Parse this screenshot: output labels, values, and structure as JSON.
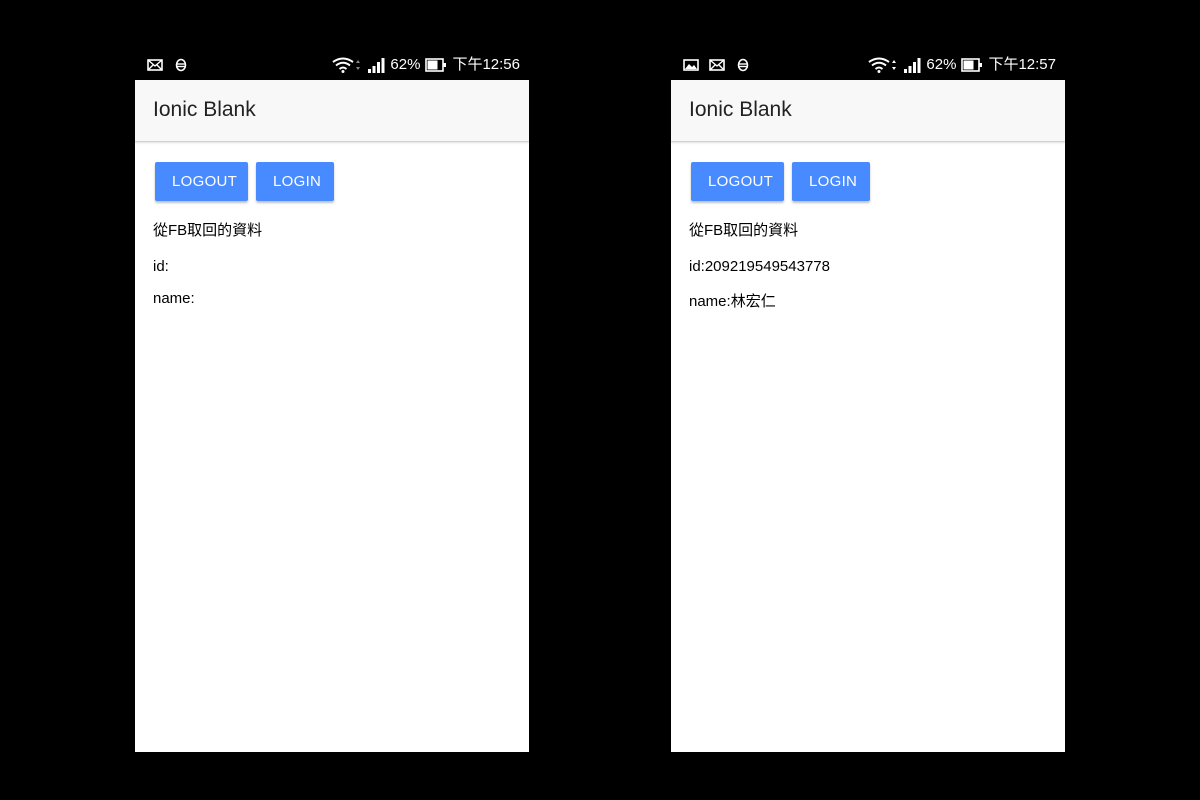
{
  "phones": [
    {
      "status": {
        "notification_icons": [
          "mail-icon",
          "sync-icon"
        ],
        "battery": "62%",
        "time": "下午12:56"
      },
      "toolbar": {
        "title": "Ionic Blank"
      },
      "buttons": {
        "logout": "LOGOUT",
        "login": "LOGIN"
      },
      "heading": "從FB取回的資料",
      "id_line": "id:",
      "name_line": "name:"
    },
    {
      "status": {
        "notification_icons": [
          "image-icon",
          "mail-icon",
          "sync-icon"
        ],
        "battery": "62%",
        "time": "下午12:57"
      },
      "toolbar": {
        "title": "Ionic Blank"
      },
      "buttons": {
        "logout": "LOGOUT",
        "login": "LOGIN"
      },
      "heading": "從FB取回的資料",
      "id_line": "id:209219549543778",
      "name_line": "name:林宏仁"
    }
  ],
  "colors": {
    "button": "#488aff",
    "toolbar": "#f8f8f8",
    "background": "#000000"
  }
}
